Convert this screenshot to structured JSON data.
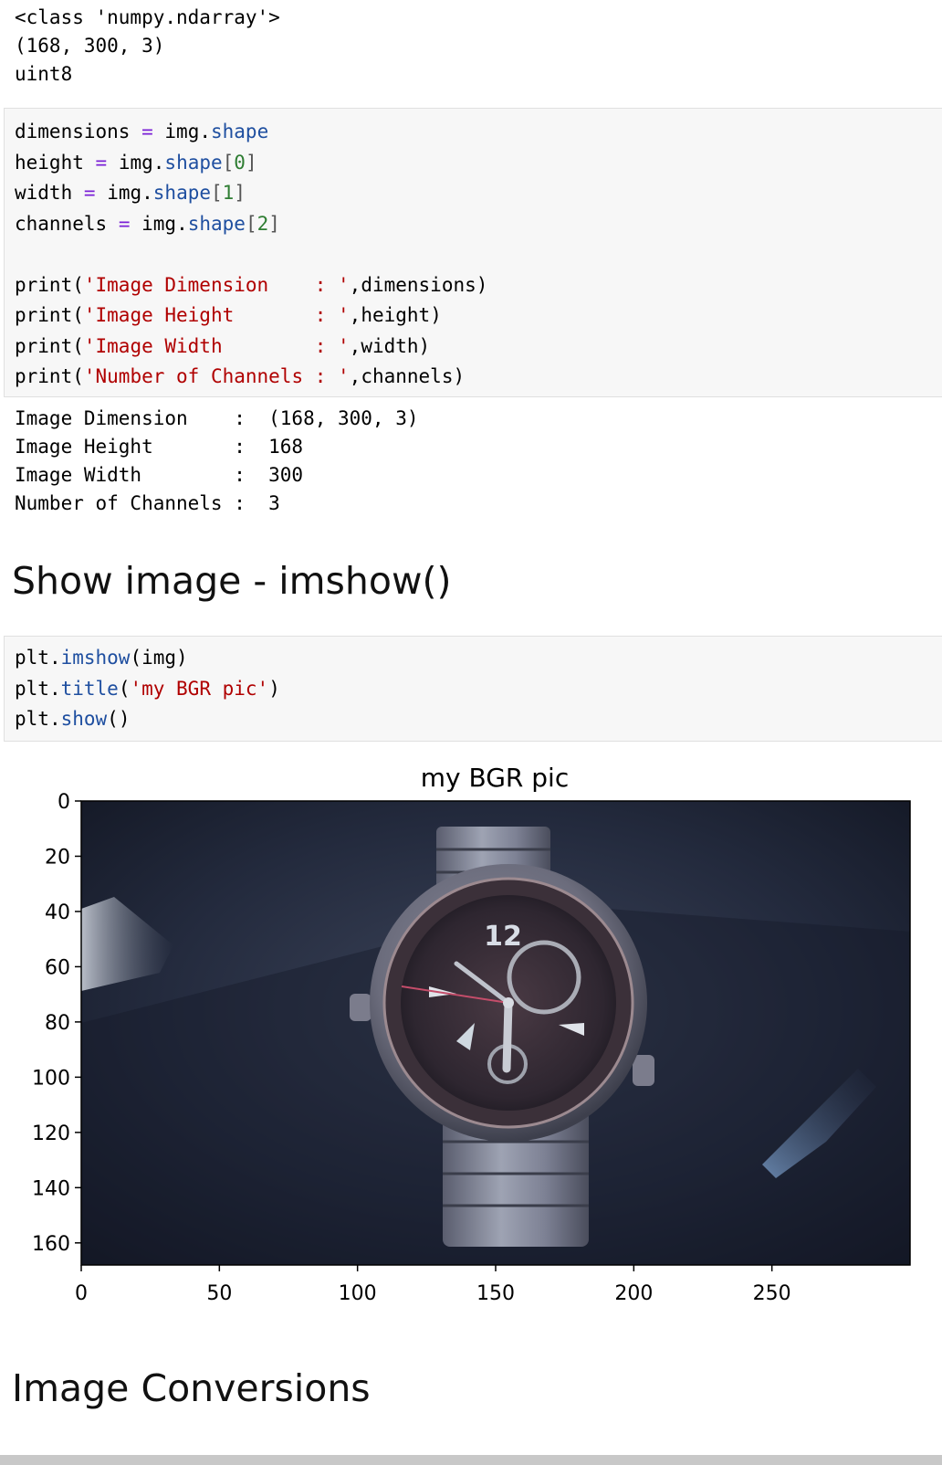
{
  "cell1_output": {
    "lines": [
      "<class 'numpy.ndarray'>",
      "(168, 300, 3)",
      "uint8"
    ]
  },
  "cell2_code": {
    "l1": {
      "var": "dimensions",
      "eq": "=",
      "obj": "img",
      "attr": "shape"
    },
    "l2": {
      "var": "height",
      "eq": "=",
      "obj": "img",
      "attr": "shape",
      "idx": "0"
    },
    "l3": {
      "var": "width",
      "eq": "=",
      "obj": "img",
      "attr": "shape",
      "idx": "1"
    },
    "l4": {
      "var": "channels",
      "eq": "=",
      "obj": "img",
      "attr": "shape",
      "idx": "2"
    },
    "p1": {
      "fn": "print",
      "str": "'Image Dimension    : '",
      "arg": "dimensions"
    },
    "p2": {
      "fn": "print",
      "str": "'Image Height       : '",
      "arg": "height"
    },
    "p3": {
      "fn": "print",
      "str": "'Image Width        : '",
      "arg": "width"
    },
    "p4": {
      "fn": "print",
      "str": "'Number of Channels : '",
      "arg": "channels"
    }
  },
  "cell2_output": {
    "lines": [
      "Image Dimension    :  (168, 300, 3)",
      "Image Height       :  168",
      "Image Width        :  300",
      "Number of Channels :  3"
    ]
  },
  "heading_show": "Show image - imshow()",
  "cell3_code": {
    "l1": {
      "obj": "plt",
      "fn": "imshow",
      "arg": "img"
    },
    "l2": {
      "obj": "plt",
      "fn": "title",
      "str": "'my BGR pic'"
    },
    "l3": {
      "obj": "plt",
      "fn": "show"
    }
  },
  "chart_data": {
    "type": "heatmap",
    "title": "my BGR pic",
    "xlim": [
      0,
      300
    ],
    "ylim": [
      168,
      0
    ],
    "xticks": [
      0,
      50,
      100,
      150,
      200,
      250
    ],
    "yticks": [
      0,
      20,
      40,
      60,
      80,
      100,
      120,
      140,
      160
    ],
    "image_description": "wristwatch on a dark wooden surface, displayed with BGR channel order",
    "watch_dial_number": "12"
  },
  "heading_conversions": "Image Conversions"
}
